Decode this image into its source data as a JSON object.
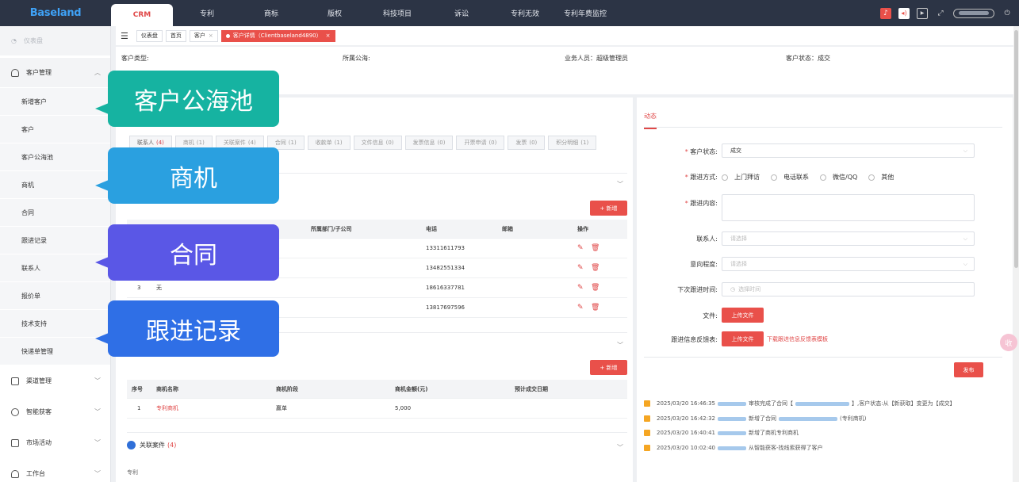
{
  "app": {
    "logo": "Baseland"
  },
  "nav": {
    "tabs": [
      "CRM",
      "专利",
      "商标",
      "版权",
      "科技项目",
      "诉讼",
      "专利无效",
      "专利年费监控"
    ]
  },
  "topbar": {
    "icons": [
      "bell-icon",
      "volume-icon",
      "play-icon",
      "fullscreen-icon",
      "user-menu",
      "power-icon"
    ]
  },
  "sidebar": {
    "dashboard": "仪表盘",
    "customer_group": "客户管理",
    "customer_items": [
      "新增客户",
      "客户",
      "客户公海池",
      "商机",
      "合同",
      "跟进记录",
      "联系人",
      "报价单",
      "技术支持",
      "快递单管理"
    ],
    "groups": [
      "渠道管理",
      "智能获客",
      "市场活动",
      "工作台"
    ]
  },
  "breadcrumbs": {
    "items": [
      "仪表盘",
      "首页",
      "客户"
    ],
    "active": "客户详情（Clientbaseland4890）",
    "close": "×"
  },
  "info": {
    "type": "客户类型:",
    "sea": "所属公海:",
    "staff": "业务人员：超级管理员",
    "status": "客户状态：成交"
  },
  "tabs": [
    {
      "label": "联系人",
      "count": "(4)"
    },
    {
      "label": "商机",
      "count": "(1)"
    },
    {
      "label": "关联案件",
      "count": "(4)"
    },
    {
      "label": "合同",
      "count": "(1)"
    },
    {
      "label": "收款单",
      "count": "(1)"
    },
    {
      "label": "文件信息",
      "count": "(0)"
    },
    {
      "label": "发票信息",
      "count": "(0)"
    },
    {
      "label": "开票申请",
      "count": "(0)"
    },
    {
      "label": "发票",
      "count": "(0)"
    },
    {
      "label": "积分明细",
      "count": "(1)"
    }
  ],
  "contacts": {
    "add_label": "+ 新增",
    "headers": {
      "dept": "所属部门/子公司",
      "phone": "电话",
      "email": "邮箱",
      "op": "操作"
    },
    "rows": [
      {
        "no": "",
        "name": "",
        "phone": "13311611793"
      },
      {
        "no": "",
        "name": "",
        "phone": "13482551334"
      },
      {
        "no": "3",
        "name": "无",
        "phone": "18616337781"
      },
      {
        "no": "",
        "name": "",
        "phone": "13817697596"
      }
    ]
  },
  "opportunities": {
    "add_label": "+ 新增",
    "headers": {
      "no": "序号",
      "name": "商机名称",
      "stage": "商机阶段",
      "amount": "商机金额(元)",
      "date": "预计成交日期"
    },
    "rows": [
      {
        "no": "1",
        "name": "专利商机",
        "stage": "赢单",
        "amount": "5,000",
        "date": ""
      }
    ]
  },
  "related": {
    "title": "关联案件",
    "count": "(4)",
    "sub": "专利"
  },
  "follow": {
    "tab": "动态",
    "status_label": "客户状态:",
    "status_value": "成交",
    "method_label": "跟进方式:",
    "methods": [
      "上门拜访",
      "电话联系",
      "微信/QQ",
      "其他"
    ],
    "content_label": "跟进内容:",
    "contact_label": "联系人:",
    "contact_placeholder": "请选择",
    "intent_label": "意向程度:",
    "intent_placeholder": "请选择",
    "next_label": "下次跟进时间:",
    "next_placeholder": "选择时间",
    "file_label": "文件:",
    "upload": "上传文件",
    "feedback_label": "跟进信息反馈表:",
    "template_link": "下载跟进信息反馈表模板",
    "publish": "发布",
    "dd": "⌵",
    "clock": "◷"
  },
  "logs": [
    {
      "time": "2025/03/20 16:46:35",
      "pre": "审核完成了合同【",
      "mid": "】,客户状态:从【新获取】变更为【成交】"
    },
    {
      "time": "2025/03/20 16:42:32",
      "pre": "新增了合同",
      "mid": "(专利商机)"
    },
    {
      "time": "2025/03/20 16:40:41",
      "pre": "新增了商机专利商机",
      "mid": ""
    },
    {
      "time": "2025/03/20 10:02:40",
      "pre": "从智能获客-找线索获得了客户",
      "mid": ""
    }
  ],
  "callouts": [
    {
      "text": "客户公海池",
      "color": "#16b3a1"
    },
    {
      "text": "商机",
      "color": "#2aa0e0"
    },
    {
      "text": "合同",
      "color": "#5a57e6"
    },
    {
      "text": "跟进记录",
      "color": "#2f6fe6"
    }
  ],
  "float_badge": "收"
}
